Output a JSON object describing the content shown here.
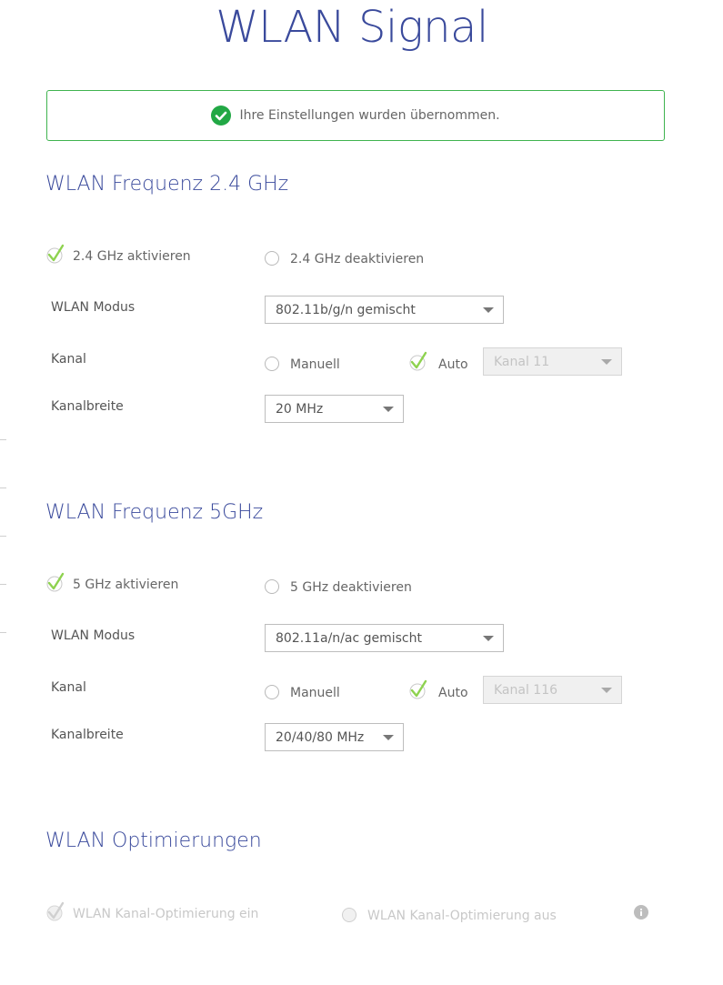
{
  "page": {
    "title": "WLAN Signal"
  },
  "alert": {
    "message": "Ihre Einstellungen wurden übernommen.",
    "color": "#3fb34f"
  },
  "band_24": {
    "heading": "WLAN Frequenz 2.4 GHz",
    "enable_label": "2.4 GHz aktivieren",
    "disable_label": "2.4 GHz deaktivieren",
    "enabled": true,
    "mode_label": "WLAN Modus",
    "mode_value": "802.11b/g/n gemischt",
    "channel_label": "Kanal",
    "channel_manual_label": "Manuell",
    "channel_auto_label": "Auto",
    "channel_auto": true,
    "channel_value": "Kanal 11",
    "width_label": "Kanalbreite",
    "width_value": "20 MHz"
  },
  "band_5": {
    "heading": "WLAN Frequenz 5GHz",
    "enable_label": "5 GHz aktivieren",
    "disable_label": "5 GHz deaktivieren",
    "enabled": true,
    "mode_label": "WLAN Modus",
    "mode_value": "802.11a/n/ac gemischt",
    "channel_label": "Kanal",
    "channel_manual_label": "Manuell",
    "channel_auto_label": "Auto",
    "channel_auto": true,
    "channel_value": "Kanal 116",
    "width_label": "Kanalbreite",
    "width_value": "20/40/80 MHz"
  },
  "optimization": {
    "heading": "WLAN Optimierungen",
    "on_label": "WLAN Kanal-Optimierung ein",
    "off_label": "WLAN Kanal-Optimierung aus",
    "on_selected": true,
    "disabled": true
  },
  "icons": {
    "success": "check-circle-icon",
    "checked": "checkmark-icon",
    "info": "info-icon"
  },
  "colors": {
    "heading": "#3a4a9c",
    "success": "#3fb34f",
    "check": "#8ed24f"
  }
}
